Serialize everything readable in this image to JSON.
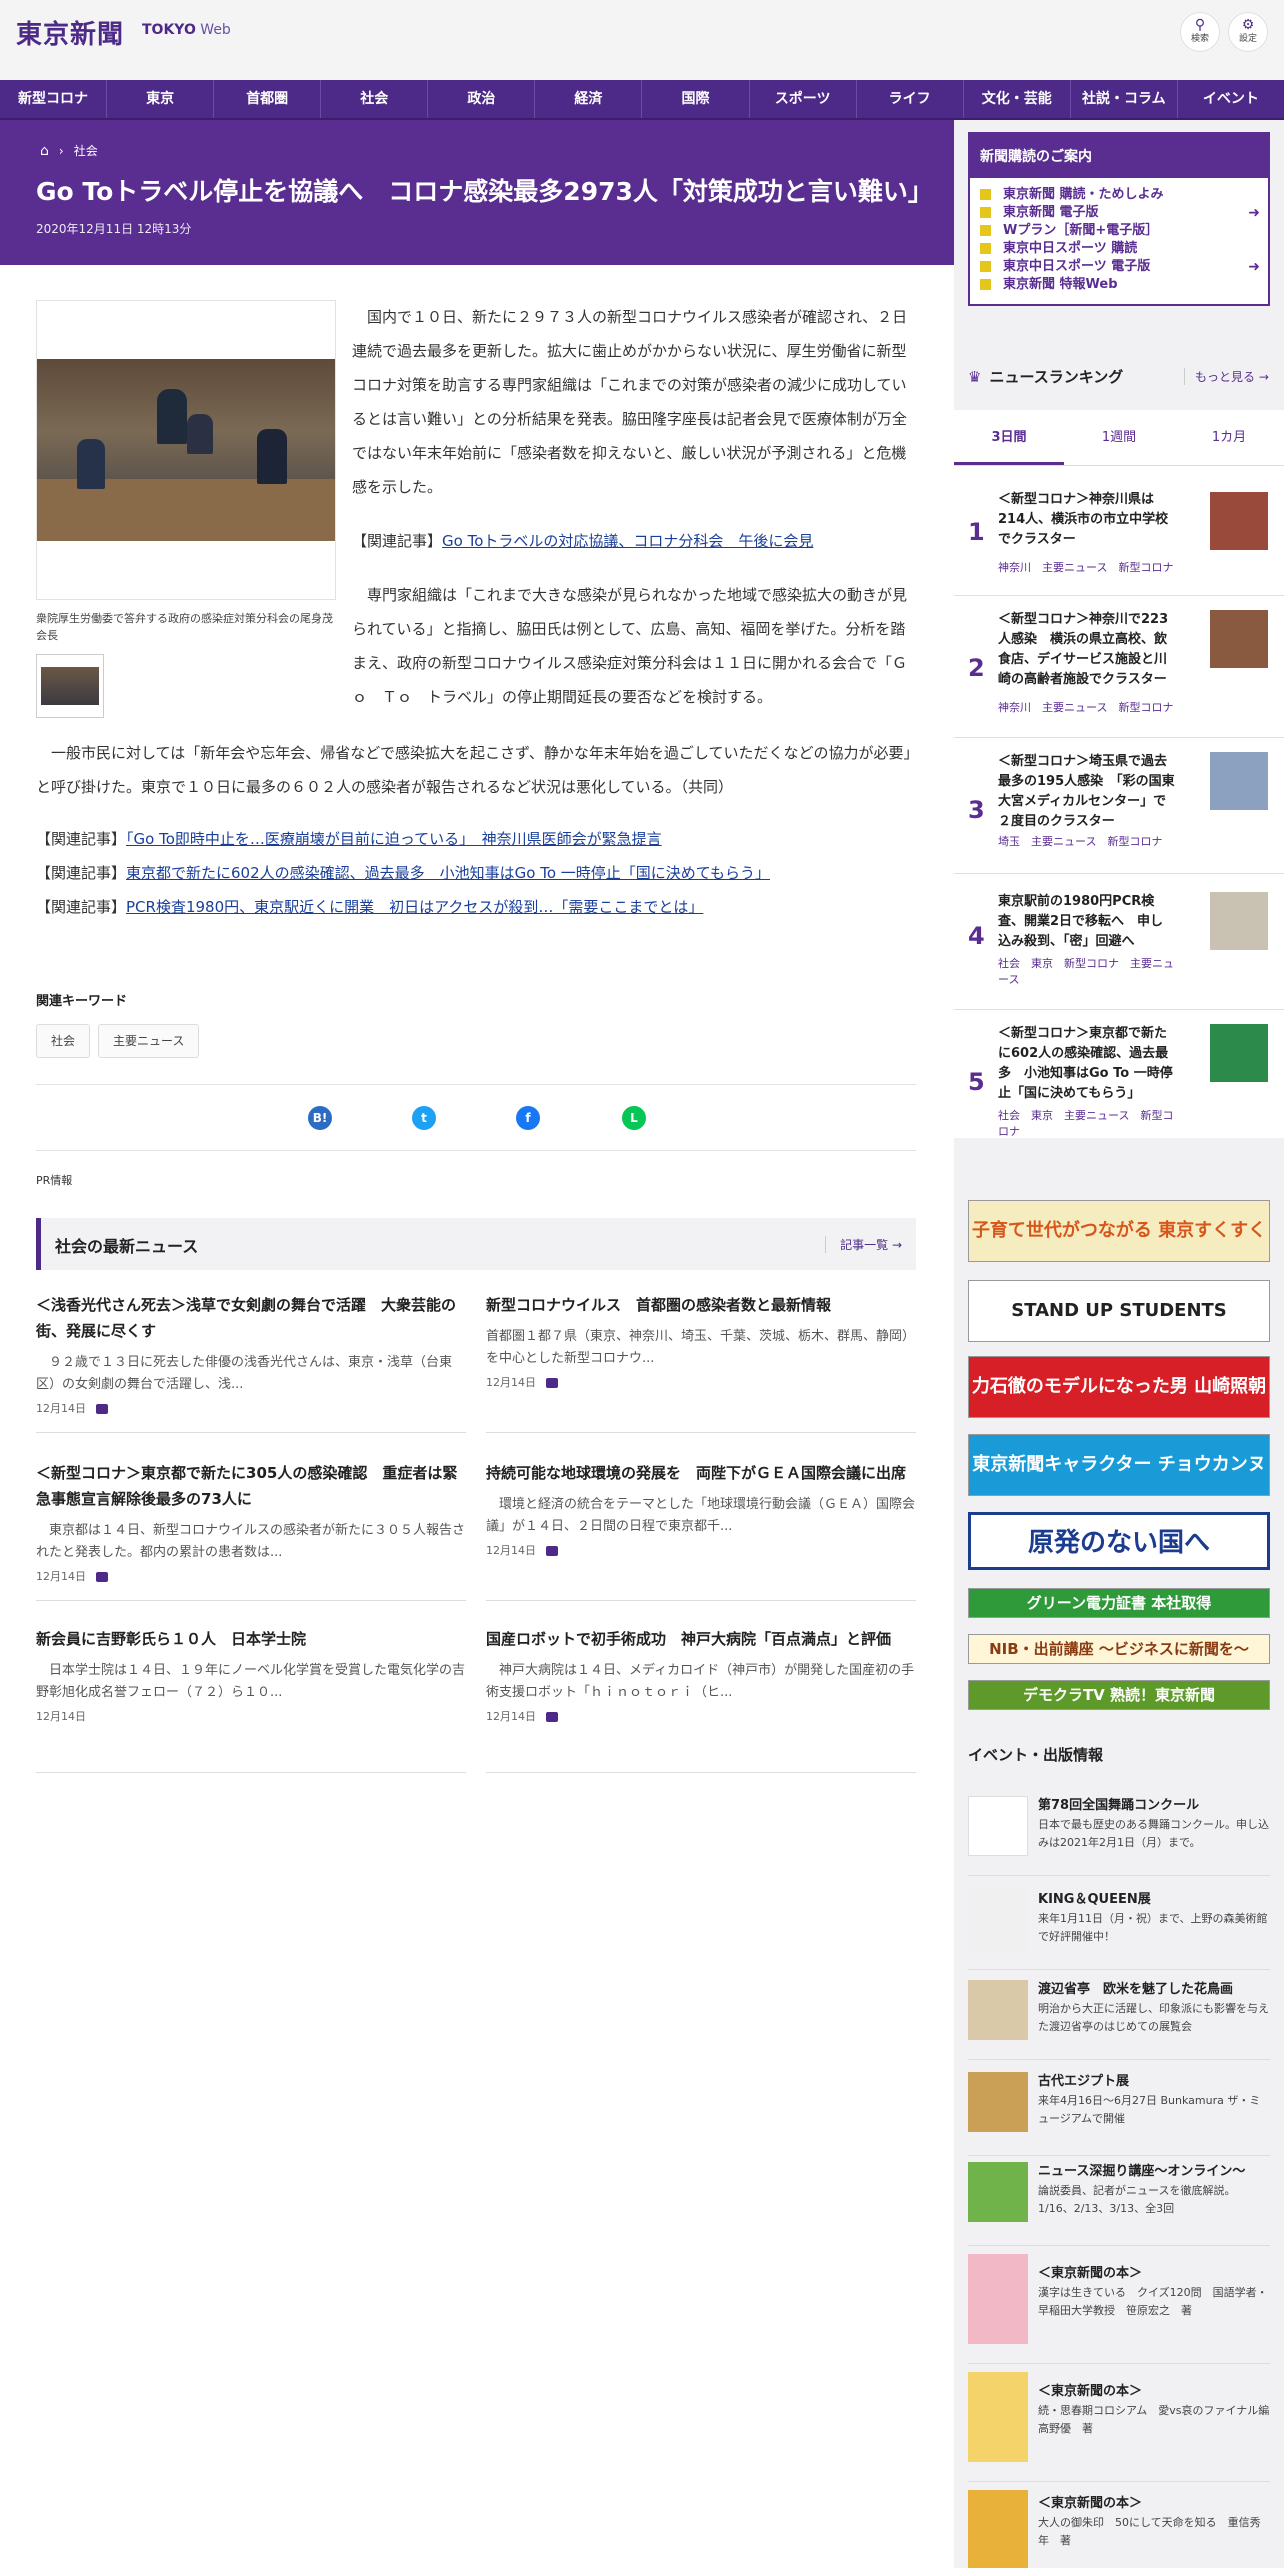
{
  "header": {
    "logo": "東京新聞",
    "logo_sub_a": "TOKYO",
    "logo_sub_b": " Web",
    "search_label": "検索",
    "settings_label": "設定"
  },
  "nav": [
    "新型コロナ",
    "東京",
    "首都圏",
    "社会",
    "政治",
    "経済",
    "国際",
    "スポーツ",
    "ライフ",
    "文化・芸能",
    "社説・コラム",
    "イベント"
  ],
  "article": {
    "breadcrumb": "社会",
    "title": "Go Toトラベル停止を協議へ　コロナ感染最多2973人「対策成功と言い難い」",
    "date": "2020年12月11日 12時13分",
    "photo_caption": "衆院厚生労働委で答弁する政府の感染症対策分科会の尾身茂会長",
    "para1": "　国内で１０日、新たに２９７３人の新型コロナウイルス感染者が確認され、２日連続で過去最多を更新した。拡大に歯止めがかからない状況に、厚生労働省に新型コロナ対策を助言する専門家組織は「これまでの対策が感染者の減少に成功しているとは言い難い」との分析結果を発表。脇田隆字座長は記者会見で医療体制が万全ではない年末年始前に「感染者数を抑えないと、厳しい状況が予測される」と危機感を示した。",
    "related_inline_prefix": "【関連記事】",
    "related_inline_link": "Go Toトラベルの対応協議、コロナ分科会　午後に会見",
    "para2": "　専門家組織は「これまで大きな感染が見られなかった地域で感染拡大の動きが見られている」と指摘し、脇田氏は例として、広島、高知、福岡を挙げた。分析を踏まえ、政府の新型コロナウイルス感染症対策分科会は１１日に開かれる会合で「Ｇｏ　Ｔｏ　トラベル」の停止期間延長の要否などを検討する。",
    "para3": "　一般市民に対しては「新年会や忘年会、帰省などで感染拡大を起こさず、静かな年末年始を過ごしていただくなどの協力が必要」と呼び掛けた。東京で１０日に最多の６０２人の感染者が報告されるなど状況は悪化している。（共同）",
    "related": [
      {
        "prefix": "【関連記事】",
        "link": "「Go To即時中止を…医療崩壊が目前に迫っている」　神奈川県医師会が緊急提言"
      },
      {
        "prefix": "【関連記事】",
        "link": "東京都で新たに602人の感染確認、過去最多　小池知事はGo To 一時停止「国に決めてもらう」"
      },
      {
        "prefix": "【関連記事】",
        "link": "PCR検査1980円、東京駅近くに開業　初日はアクセスが殺到…「需要ここまでとは」"
      }
    ],
    "keywords_title": "関連キーワード",
    "keywords": [
      "社会",
      "主要ニュース"
    ],
    "pr_label": "PR情報"
  },
  "share": [
    {
      "label": "B!",
      "color": "#2b6cc4"
    },
    {
      "label": "t",
      "color": "#1da1f2"
    },
    {
      "label": "f",
      "color": "#1877f2"
    },
    {
      "label": "L",
      "color": "#06c755"
    }
  ],
  "latest": {
    "title": "社会の最新ニュース",
    "more": "記事一覧",
    "items": [
      {
        "h": "＜浅香光代さん死去＞浅草で女剣劇の舞台で活躍　大衆芸能の街、発展に尽くす",
        "s": "　９２歳で１３日に死去した俳優の浅香光代さんは、東京・浅草（台東区）の女剣劇の舞台で活躍し、浅...",
        "d": "12月14日"
      },
      {
        "h": "新型コロナウイルス　首都圏の感染者数と最新情報",
        "s": "首都圏１都７県（東京、神奈川、埼玉、千葉、茨城、栃木、群馬、静岡）を中心とした新型コロナウ...",
        "d": "12月14日"
      },
      {
        "h": "＜新型コロナ＞東京都で新たに305人の感染確認　重症者は緊急事態宣言解除後最多の73人に",
        "s": "　東京都は１４日、新型コロナウイルスの感染者が新たに３０５人報告されたと発表した。都内の累計の患者数は...",
        "d": "12月14日"
      },
      {
        "h": "持続可能な地球環境の発展を　両陛下がＧＥＡ国際会議に出席",
        "s": "　環境と経済の統合をテーマとした「地球環境行動会議（ＧＥＡ）国際会議」が１４日、２日間の日程で東京都千...",
        "d": "12月14日"
      },
      {
        "h": "新会員に吉野彰氏ら１０人　日本学士院",
        "s": "　日本学士院は１４日、１９年にノーベル化学賞を受賞した電気化学の吉野彰旭化成名誉フェロー（７２）ら１０...",
        "d": "12月14日"
      },
      {
        "h": "国産ロボットで初手術成功　神戸大病院「百点満点」と評価",
        "s": "　神戸大病院は１４日、メディカロイド（神戸市）が開発した国産初の手術支援ロボット「ｈｉｎｏｔｏｒｉ（ヒ...",
        "d": "12月14日"
      }
    ]
  },
  "sidebar": {
    "subscription_title": "新聞購読のご案内",
    "subscription_items": [
      "東京新聞 購読・ためしよみ",
      "東京新聞 電子版",
      "Wプラン［新聞+電子版］",
      "東京中日スポーツ 購読",
      "東京中日スポーツ 電子版",
      "東京新聞 特報Web"
    ],
    "ranking_title": "ニュースランキング",
    "ranking_more": "もっと見る",
    "ranking_tabs": [
      "3日間",
      "1週間",
      "1カ月"
    ],
    "ranking": [
      {
        "n": "1",
        "h": "＜新型コロナ＞神奈川県は214人、横浜市の市立中学校でクラスター",
        "tags": "神奈川　主要ニュース　新型コロナ"
      },
      {
        "n": "2",
        "h": "＜新型コロナ＞神奈川で223人感染　横浜の県立高校、飲食店、デイサービス施設と川崎の高齢者施設でクラスター",
        "tags": "神奈川　主要ニュース　新型コロナ"
      },
      {
        "n": "3",
        "h": "＜新型コロナ＞埼玉県で過去最多の195人感染　「彩の国東大宮メディカルセンター」で２度目のクラスター",
        "tags": "埼玉　主要ニュース　新型コロナ"
      },
      {
        "n": "4",
        "h": "東京駅前の1980円PCR検査、開業2日で移転へ　申し込み殺到、「密」回避へ",
        "tags": "社会　東京　新型コロナ　主要ニュース"
      },
      {
        "n": "5",
        "h": "＜新型コロナ＞東京都で新たに602人の感染確認、過去最多　小池知事はGo To 一時停止「国に決めてもらう」",
        "tags": "社会　東京　主要ニュース　新型コロナ"
      }
    ],
    "banners": [
      {
        "text": "子育て世代がつながる 東京すくすく",
        "bg": "#f5ecc0",
        "fg": "#d8561b"
      },
      {
        "text": "STAND UP STUDENTS",
        "bg": "#ffffff",
        "fg": "#222222"
      },
      {
        "text": "力石徹のモデルになった男 山崎照朝",
        "bg": "#d61f26",
        "fg": "#ffffff"
      },
      {
        "text": "東京新聞キャラクター チョウカンヌ",
        "bg": "#1a9bd7",
        "fg": "#ffffff"
      },
      {
        "text": "原発のない国へ",
        "bg": "#ffffff",
        "fg": "#1b3c8f"
      },
      {
        "text": "グリーン電力証書 本社取得",
        "bg": "#2f9a3a",
        "fg": "#ffffff"
      },
      {
        "text": "NIB・出前講座 〜ビジネスに新聞を〜",
        "bg": "#fff6d8",
        "fg": "#8a3b12"
      },
      {
        "text": "デモクラTV 熟読！東京新聞",
        "bg": "#5e9a2a",
        "fg": "#ffffff"
      }
    ],
    "events_title": "イベント・出版情報",
    "events": [
      {
        "h": "第78回全国舞踊コンクール",
        "s": "日本で最も歴史のある舞踊コンクール。申し込みは2021年2月1日（月）まで。",
        "bg": "#ffffff"
      },
      {
        "h": "KING＆QUEEN展",
        "s": "来年1月11日（月・祝）まで、上野の森美術館で好評開催中！",
        "bg": "#f0f0f0"
      },
      {
        "h": "渡辺省亭　欧米を魅了した花鳥画",
        "s": "明治から大正に活躍し、印象派にも影響を与えた渡辺省亭のはじめての展覧会",
        "bg": "#d9c9a8"
      },
      {
        "h": "古代エジプト展",
        "s": "来年4月16日～6月27日 Bunkamura ザ・ミュージアムで開催",
        "bg": "#c9a055"
      },
      {
        "h": "ニュース深掘り講座～オンライン～",
        "s": "論説委員、記者がニュースを徹底解説。1/16、2/13、3/13、全3回",
        "bg": "#6fb34a"
      },
      {
        "h": "＜東京新聞の本＞",
        "s": "漢字は生きている　クイズ120問　国語学者・早稲田大学教授　笹原宏之　著",
        "bg": "#f2b8c6"
      },
      {
        "h": "＜東京新聞の本＞",
        "s": "続・思春期コロシアム　愛vs哀のファイナル編　高野優　著",
        "bg": "#f3d36a"
      },
      {
        "h": "＜東京新聞の本＞",
        "s": "大人の御朱印　50にして天命を知る　重信秀年　著",
        "bg": "#e8b23a"
      }
    ]
  }
}
